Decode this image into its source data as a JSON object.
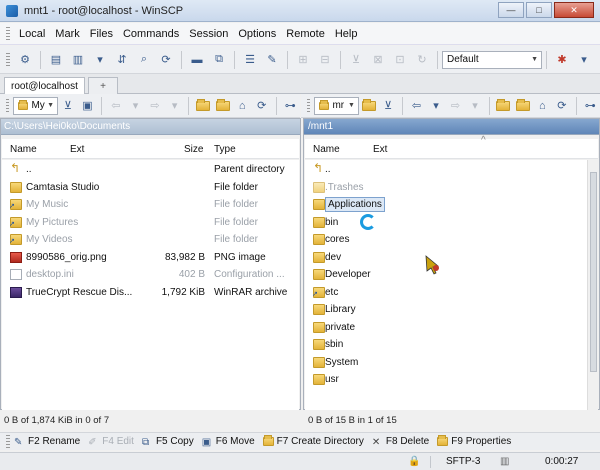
{
  "window": {
    "title": "mnt1 - root@localhost - WinSCP",
    "minimize": "—",
    "maximize": "□",
    "close": "✕"
  },
  "menu": [
    "Local",
    "Mark",
    "Files",
    "Commands",
    "Session",
    "Options",
    "Remote",
    "Help"
  ],
  "toolbar": {
    "profile": "Default"
  },
  "tabs": {
    "session": "root@localhost",
    "add": "+"
  },
  "left": {
    "drive": "My",
    "path": "C:\\Users\\Hei0ko\\Documents",
    "cols": {
      "name": "Name",
      "ext": "Ext",
      "size": "Size",
      "type": "Type"
    },
    "files": [
      {
        "name": "..",
        "size": "",
        "type": "Parent directory",
        "icon": "up",
        "hidden": false
      },
      {
        "name": "Camtasia Studio",
        "size": "",
        "type": "File folder",
        "icon": "folder",
        "hidden": false
      },
      {
        "name": "My Music",
        "size": "",
        "type": "File folder",
        "icon": "link",
        "hidden": true
      },
      {
        "name": "My Pictures",
        "size": "",
        "type": "File folder",
        "icon": "link",
        "hidden": true
      },
      {
        "name": "My Videos",
        "size": "",
        "type": "File folder",
        "icon": "link",
        "hidden": true
      },
      {
        "name": "8990586_orig.png",
        "size": "83,982 B",
        "type": "PNG image",
        "icon": "png",
        "hidden": false
      },
      {
        "name": "desktop.ini",
        "size": "402 B",
        "type": "Configuration ...",
        "icon": "ini",
        "hidden": true
      },
      {
        "name": "TrueCrypt Rescue Dis...",
        "size": "1,792 KiB",
        "type": "WinRAR archive",
        "icon": "rar",
        "hidden": false
      }
    ],
    "status": "0 B of 1,874 KiB in 0 of 7"
  },
  "right": {
    "drive": "mr",
    "path": "/mnt1",
    "cols": {
      "name": "Name",
      "ext": "Ext"
    },
    "files": [
      {
        "name": "..",
        "icon": "up",
        "hidden": false,
        "selected": false
      },
      {
        "name": ".Trashes",
        "icon": "folder",
        "hidden": true,
        "selected": false
      },
      {
        "name": "Applications",
        "icon": "folder",
        "hidden": false,
        "selected": true
      },
      {
        "name": "bin",
        "icon": "folder",
        "hidden": false,
        "selected": false
      },
      {
        "name": "cores",
        "icon": "folder",
        "hidden": false,
        "selected": false
      },
      {
        "name": "dev",
        "icon": "folder",
        "hidden": false,
        "selected": false
      },
      {
        "name": "Developer",
        "icon": "folder",
        "hidden": false,
        "selected": false
      },
      {
        "name": "etc",
        "icon": "link",
        "hidden": false,
        "selected": false
      },
      {
        "name": "Library",
        "icon": "folder",
        "hidden": false,
        "selected": false
      },
      {
        "name": "private",
        "icon": "folder",
        "hidden": false,
        "selected": false
      },
      {
        "name": "sbin",
        "icon": "folder",
        "hidden": false,
        "selected": false
      },
      {
        "name": "System",
        "icon": "folder",
        "hidden": false,
        "selected": false
      },
      {
        "name": "usr",
        "icon": "folder",
        "hidden": false,
        "selected": false
      }
    ],
    "status": "0 B of 15 B in 1 of 15"
  },
  "fkeys": [
    {
      "label": "F2 Rename",
      "icon": "rename-icon",
      "enabled": true
    },
    {
      "label": "F4 Edit",
      "icon": "edit-icon",
      "enabled": false
    },
    {
      "label": "F5 Copy",
      "icon": "copy-icon",
      "enabled": true
    },
    {
      "label": "F6 Move",
      "icon": "move-icon",
      "enabled": true
    },
    {
      "label": "F7 Create Directory",
      "icon": "create-directory-icon",
      "enabled": true
    },
    {
      "label": "F8 Delete",
      "icon": "delete-icon",
      "enabled": true
    },
    {
      "label": "F9 Properties",
      "icon": "properties-icon",
      "enabled": true
    }
  ],
  "statusbar": {
    "protocol": "SFTP-3",
    "time": "0:00:27"
  },
  "colors": {
    "accent": "#5f86b8",
    "folder": "#e3b339",
    "selection": "#dce8f6"
  }
}
